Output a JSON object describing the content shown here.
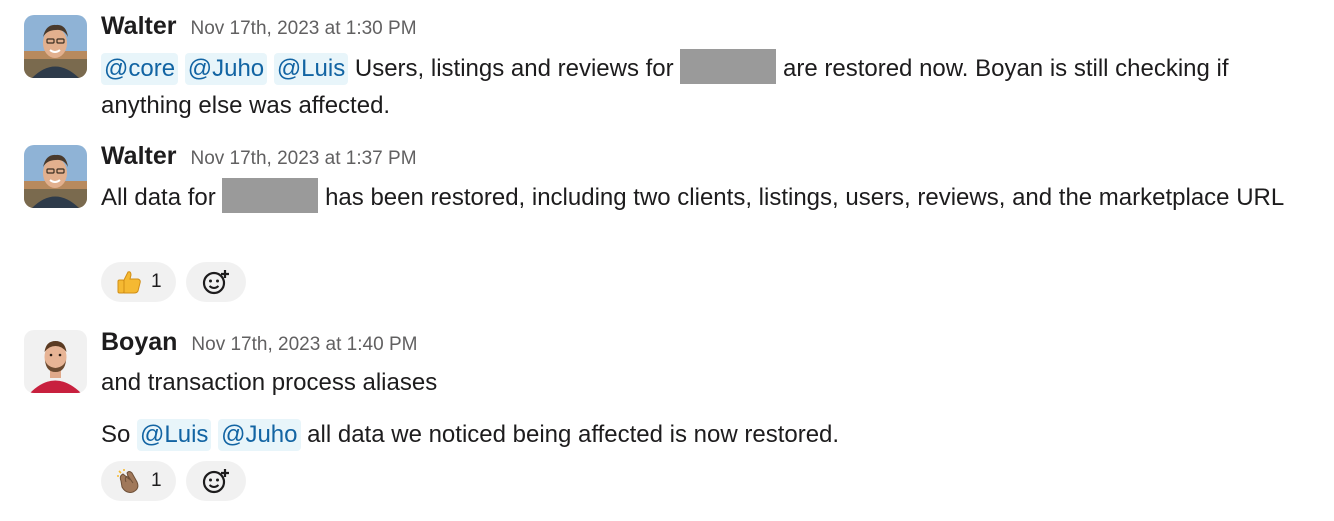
{
  "messages": [
    {
      "author": "Walter",
      "timestamp": "Nov 17th, 2023 at 1:30 PM",
      "avatar_icon": "walter-avatar",
      "mentions": [
        "@core",
        "@Juho",
        "@Luis"
      ],
      "text_a": "Users, listings and reviews for",
      "text_b": "are restored now. Boyan is still checking if anything else was affected."
    },
    {
      "author": "Walter",
      "timestamp": "Nov 17th, 2023 at 1:37 PM",
      "avatar_icon": "walter-avatar",
      "text_a": "All data for",
      "text_b": "has been restored, including two clients, listings, users, reviews, and the marketplace URL",
      "reactions": [
        {
          "emoji": "thumbs-up-icon",
          "count": "1"
        }
      ]
    },
    {
      "author": "Boyan",
      "timestamp": "Nov 17th, 2023 at 1:40 PM",
      "avatar_icon": "boyan-avatar",
      "line1": "and transaction process aliases",
      "line2_prefix": "So",
      "mentions": [
        "@Luis",
        "@Juho"
      ],
      "line2_suffix": "all data we noticed being affected is now restored.",
      "reactions": [
        {
          "emoji": "clapping-hands-icon",
          "count": "1"
        }
      ]
    }
  ],
  "colors": {
    "mention_text": "#1264a3",
    "mention_bg": "#e8f5fa",
    "timestamp": "#616061",
    "reaction_bg": "#f1f1f1",
    "redacted": "#9a9a9a"
  }
}
